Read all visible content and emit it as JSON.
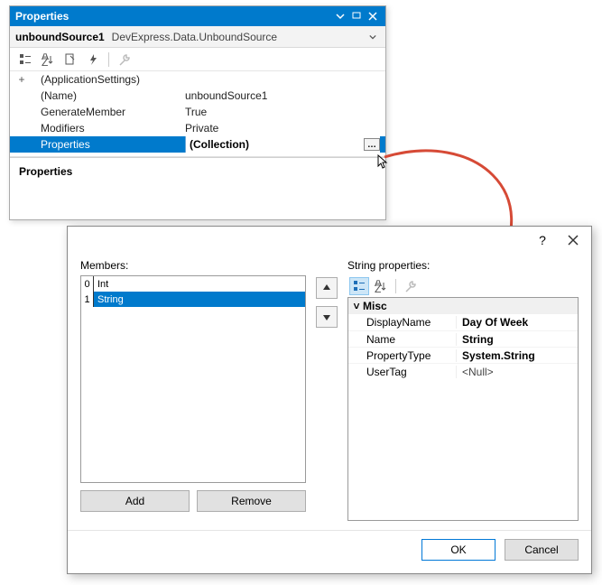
{
  "propPanel": {
    "title": "Properties",
    "objectName": "unboundSource1",
    "objectType": "DevExpress.Data.UnboundSource",
    "rows": [
      {
        "expand": "+",
        "key": "(ApplicationSettings)",
        "val": ""
      },
      {
        "expand": "",
        "key": "(Name)",
        "val": "unboundSource1"
      },
      {
        "expand": "",
        "key": "GenerateMember",
        "val": "True"
      },
      {
        "expand": "",
        "key": "Modifiers",
        "val": "Private"
      },
      {
        "expand": "",
        "key": "Properties",
        "val": "(Collection)",
        "selected": true,
        "ellipsis": true
      }
    ],
    "description": {
      "title": "Properties"
    }
  },
  "editor": {
    "help": "?",
    "membersLabel": "Members:",
    "members": [
      {
        "idx": "0",
        "name": "Int",
        "selected": false
      },
      {
        "idx": "1",
        "name": "String",
        "selected": true
      }
    ],
    "addLabel": "Add",
    "removeLabel": "Remove",
    "rightLabel": "String properties:",
    "category": "Misc",
    "props": [
      {
        "key": "DisplayName",
        "val": "Day Of Week",
        "bold": true
      },
      {
        "key": "Name",
        "val": "String",
        "bold": true
      },
      {
        "key": "PropertyType",
        "val": "System.String",
        "bold": true
      },
      {
        "key": "UserTag",
        "val": "<Null>",
        "bold": false
      }
    ],
    "okLabel": "OK",
    "cancelLabel": "Cancel"
  }
}
